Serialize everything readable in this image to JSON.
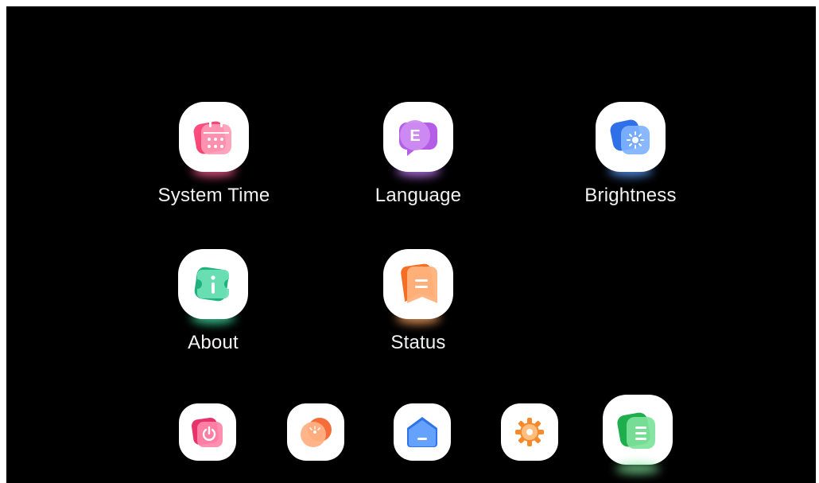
{
  "menu": {
    "items": [
      {
        "label": "System Time",
        "icon": "calendar-icon",
        "color": "#f0457a"
      },
      {
        "label": "Language",
        "icon": "language-icon",
        "color": "#b25be6"
      },
      {
        "label": "Brightness",
        "icon": "brightness-icon",
        "color": "#3f87f5"
      },
      {
        "label": "About",
        "icon": "info-icon",
        "color": "#27c28f"
      },
      {
        "label": "Status",
        "icon": "status-icon",
        "color": "#fb8a45"
      }
    ],
    "language_glyph": "E"
  },
  "dock": {
    "items": [
      {
        "icon": "power-icon",
        "color": "#f24e7c",
        "active": false
      },
      {
        "icon": "weather-icon",
        "color": "#f9925a",
        "active": false
      },
      {
        "icon": "home-icon",
        "color": "#3f87f5",
        "active": false
      },
      {
        "icon": "gear-icon",
        "color": "#f79a3e",
        "active": false
      },
      {
        "icon": "settings-list-icon",
        "color": "#35c466",
        "active": true
      }
    ]
  }
}
